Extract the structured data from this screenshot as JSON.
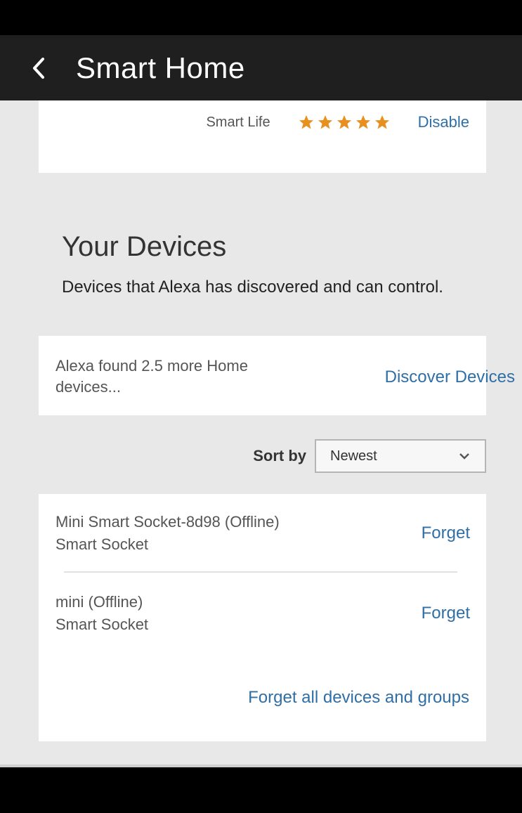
{
  "header": {
    "title": "Smart Home"
  },
  "skill": {
    "name": "Smart Life",
    "rating_stars": 5,
    "action_label": "Disable",
    "star_color": "#e8901f"
  },
  "devices_section": {
    "title": "Your Devices",
    "description": "Devices that Alexa has discovered and can control."
  },
  "discover": {
    "message": "Alexa found 2.5 more Home devices...",
    "button_label": "Discover Devices"
  },
  "sort": {
    "label": "Sort by",
    "selected": "Newest"
  },
  "devices": [
    {
      "name": "Mini Smart Socket-8d98 (Offline)",
      "type": "Smart Socket",
      "action": "Forget"
    },
    {
      "name": "mini (Offline)",
      "type": "Smart Socket",
      "action": "Forget"
    }
  ],
  "forget_all_label": "Forget all devices and groups",
  "colors": {
    "link": "#2f6fa6",
    "title_bar": "#1f1f1f",
    "background": "#e8e8e8"
  }
}
